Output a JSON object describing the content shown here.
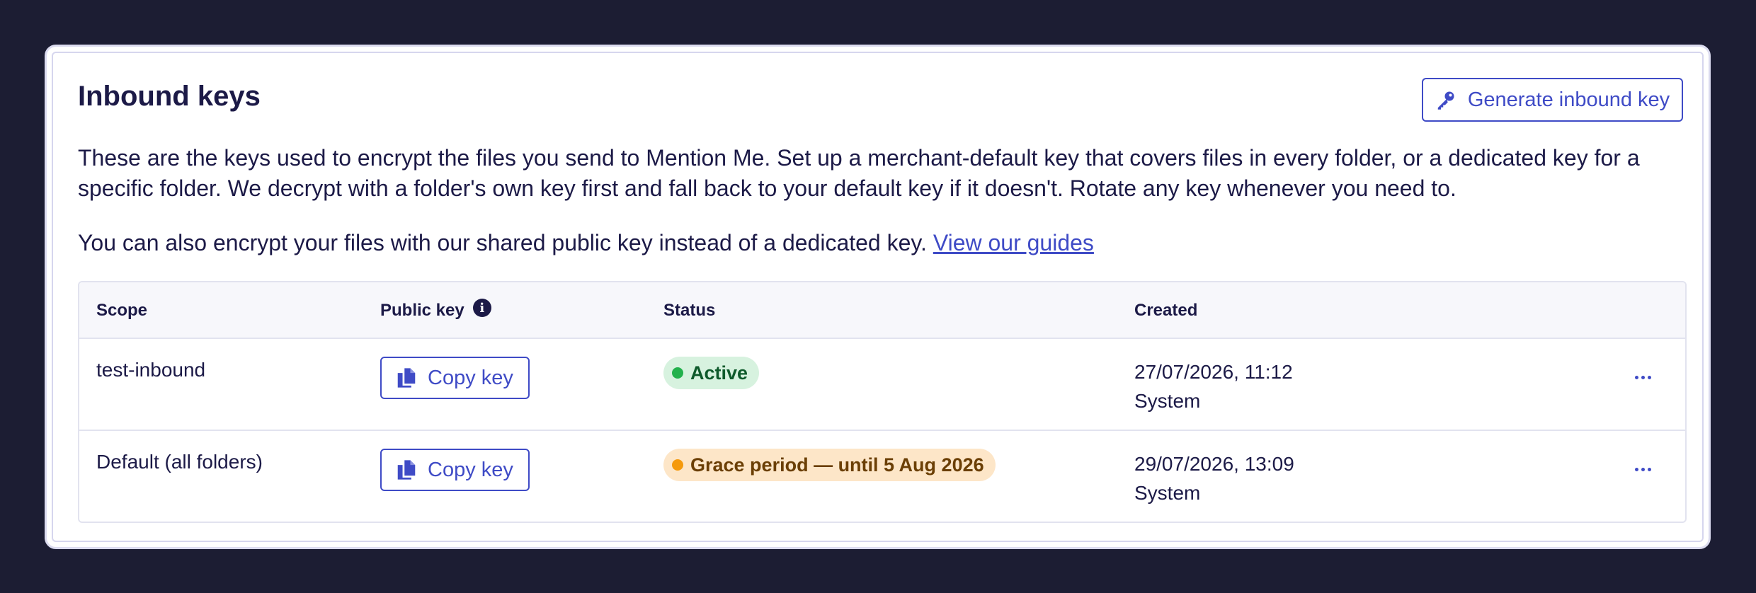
{
  "header": {
    "title": "Inbound keys",
    "generate_label": "Generate inbound key"
  },
  "intro": {
    "paragraph": "These are the keys used to encrypt the files you send to Mention Me. Set up a merchant-default key that covers files in every folder, or a dedicated key for a specific folder. We decrypt with a folder's own key first and fall back to your default key if it doesn't. Rotate any key whenever you need to.",
    "shared_key_text": "You can also encrypt your files with our shared public key instead of a dedicated key. ",
    "guides_link": "View our guides"
  },
  "table": {
    "columns": [
      "Scope",
      "Public key",
      "Status",
      "Created"
    ],
    "copy_label": "Copy key",
    "rows": [
      {
        "scope": "test-inbound",
        "status": "Active",
        "status_kind": "active",
        "created_date": "27/07/2026, 11:12",
        "created_by": "System"
      },
      {
        "scope": "Default (all folders)",
        "status": "Grace period — until 5 Aug 2026",
        "status_kind": "grace",
        "created_date": "29/07/2026, 13:09",
        "created_by": "System"
      }
    ]
  },
  "colors": {
    "accent": "#3f4bc6",
    "text": "#1c1a47",
    "active_bg": "#d7f2df",
    "active_dot": "#22b14c",
    "grace_bg": "#fde6c8",
    "grace_dot": "#f59a0c"
  },
  "icons": {
    "generate": "key-icon",
    "copy": "copy-icon",
    "info": "info-icon",
    "more": "more-horizontal-icon"
  }
}
